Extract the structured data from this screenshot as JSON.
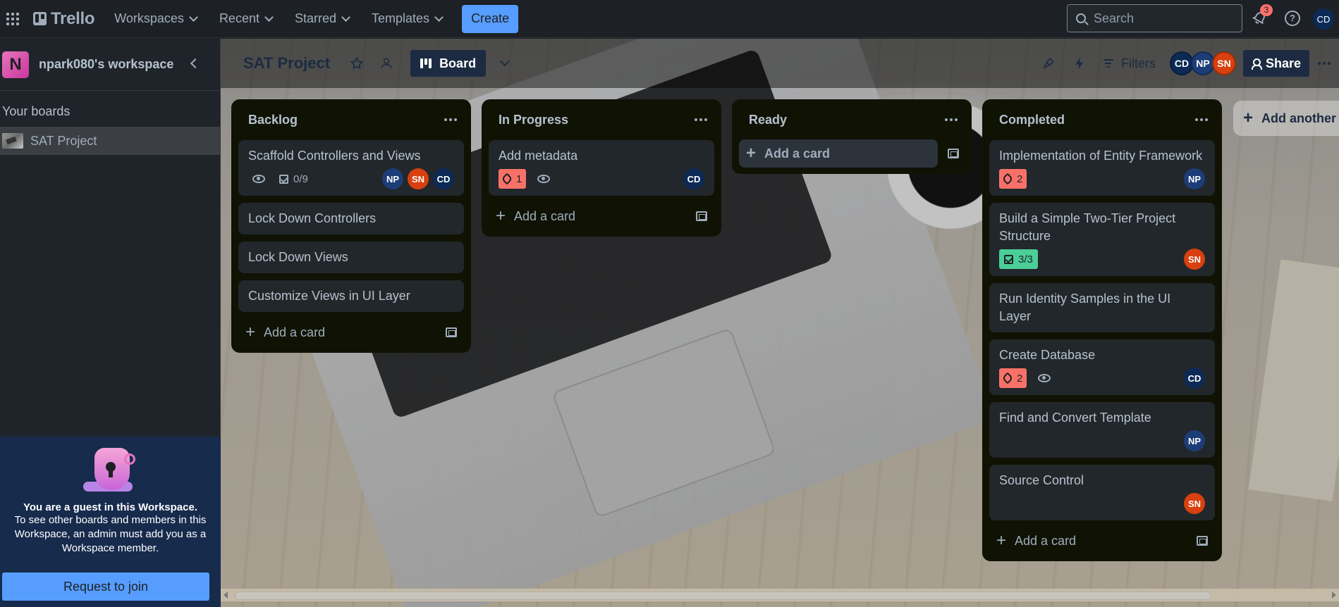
{
  "topbar": {
    "logo": "Trello",
    "nav": [
      "Workspaces",
      "Recent",
      "Starred",
      "Templates"
    ],
    "create_label": "Create",
    "search_placeholder": "Search",
    "notification_count": "3",
    "user_initials": "CD"
  },
  "sidebar": {
    "workspace_initial": "N",
    "workspace_name": "npark080's workspace",
    "boards_heading": "Your boards",
    "boards": [
      {
        "name": "SAT Project"
      }
    ],
    "guest": {
      "title": "You are a guest in this Workspace.",
      "text": "To see other boards and members in this Workspace, an admin must add you as a Workspace member.",
      "button": "Request to join"
    }
  },
  "board": {
    "title": "SAT Project",
    "view_label": "Board",
    "filters_label": "Filters",
    "share_label": "Share",
    "members": [
      {
        "initials": "CD",
        "color": "#0c2a55"
      },
      {
        "initials": "NP",
        "color": "#1c3d78"
      },
      {
        "initials": "SN",
        "color": "#d8400f"
      }
    ],
    "add_card_label": "Add a card",
    "add_list_label": "Add another list"
  },
  "lists": [
    {
      "title": "Backlog",
      "cards": [
        {
          "title": "Scaffold Controllers and Views",
          "watching": true,
          "checklist": "0/9",
          "members": [
            "NP",
            "SN",
            "CD"
          ]
        },
        {
          "title": "Lock Down Controllers"
        },
        {
          "title": "Lock Down Views"
        },
        {
          "title": "Customize Views in UI Layer"
        }
      ]
    },
    {
      "title": "In Progress",
      "cards": [
        {
          "title": "Add metadata",
          "pins": "1",
          "watching": true,
          "members": [
            "CD"
          ]
        }
      ]
    },
    {
      "title": "Ready",
      "cards": []
    },
    {
      "title": "Completed",
      "cards": [
        {
          "title": "Implementation of Entity Framework",
          "pins": "2",
          "members": [
            "NP"
          ]
        },
        {
          "title": "Build a Simple Two-Tier Project Structure",
          "checklist_complete": "3/3",
          "members": [
            "SN"
          ]
        },
        {
          "title": "Run Identity Samples in the UI Layer"
        },
        {
          "title": "Create Database",
          "pins": "2",
          "watching": true,
          "members": [
            "CD"
          ]
        },
        {
          "title": "Find and Convert Template",
          "members": [
            "NP"
          ]
        },
        {
          "title": "Source Control",
          "members": [
            "SN"
          ]
        }
      ]
    }
  ],
  "colors": {
    "accent": "#579dff",
    "member_NP": "#1c3d78",
    "member_SN": "#d8400f",
    "member_CD": "#0c2a55",
    "pin_badge": "#f87168",
    "checklist_complete": "#4bce97"
  }
}
